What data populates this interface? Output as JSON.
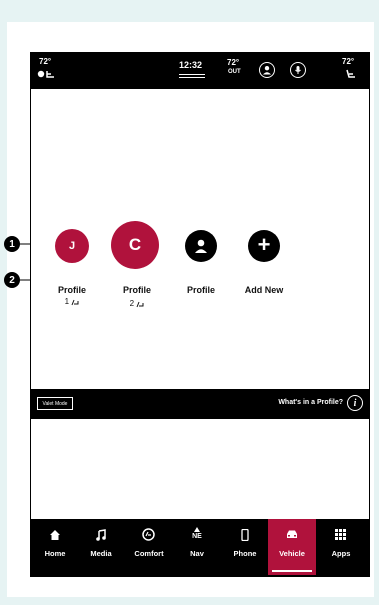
{
  "status_bar": {
    "left_temp": "72°",
    "clock": "12:32",
    "out_temp": "72°",
    "out_label": "OUT",
    "right_temp": "72°"
  },
  "profiles": [
    {
      "initial": "J",
      "label": "Profile",
      "sub": "1"
    },
    {
      "initial": "C",
      "label": "Profile",
      "sub": "2"
    },
    {
      "initial": "",
      "label": "Profile",
      "sub": ""
    },
    {
      "initial": "+",
      "label": "Add New",
      "sub": ""
    }
  ],
  "callouts": [
    "1",
    "2"
  ],
  "valet": {
    "button_label": "Valet Mode",
    "whats_text": "What's in a Profile?",
    "info_glyph": "i"
  },
  "nav": [
    {
      "label": "Home",
      "icon": "home-icon"
    },
    {
      "label": "Media",
      "icon": "music-note-icon"
    },
    {
      "label": "Comfort",
      "icon": "comfort-icon"
    },
    {
      "label": "Nav",
      "icon": "compass-icon",
      "glyph": "NE"
    },
    {
      "label": "Phone",
      "icon": "phone-icon"
    },
    {
      "label": "Vehicle",
      "icon": "vehicle-icon",
      "active": true
    },
    {
      "label": "Apps",
      "icon": "apps-grid-icon"
    }
  ],
  "colors": {
    "accent": "#b0123c",
    "background": "#e6f3f3"
  }
}
